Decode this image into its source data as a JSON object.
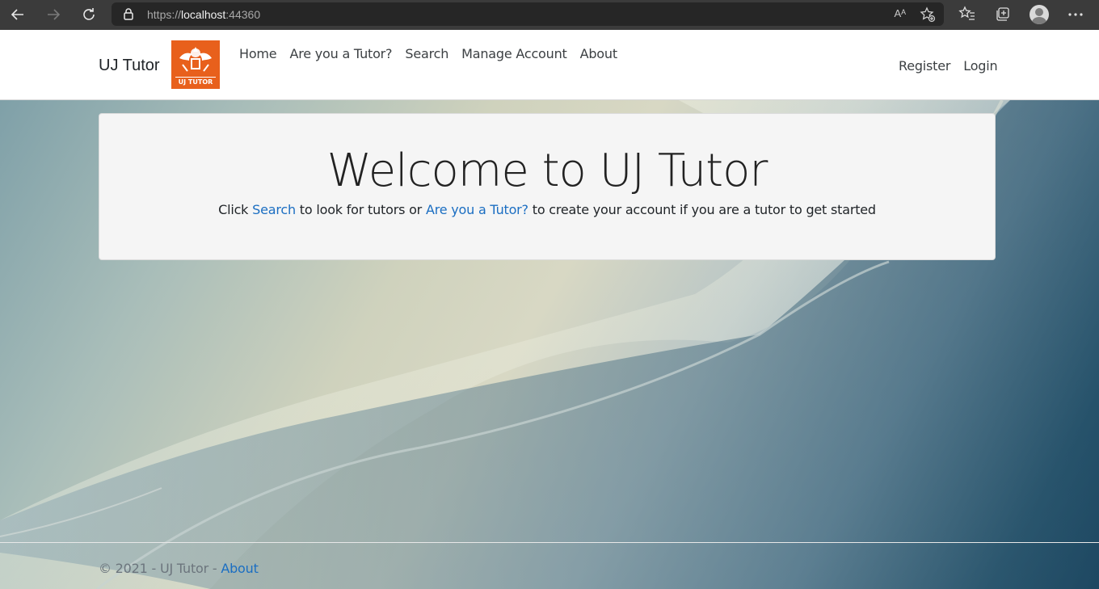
{
  "browser": {
    "url_prefix": "https://",
    "url_host": "localhost",
    "url_suffix": ":44360",
    "read_aloud": "Aᴬ"
  },
  "site": {
    "brand": "UJ Tutor",
    "logo_text": "UJ TUTOR",
    "nav": {
      "home": "Home",
      "tutor": "Are you a Tutor?",
      "search": "Search",
      "manage": "Manage Account",
      "about": "About"
    },
    "auth": {
      "register": "Register",
      "login": "Login"
    }
  },
  "jumbotron": {
    "title": "Welcome to UJ Tutor",
    "text_1": "Click ",
    "link_search": "Search",
    "text_2": " to look for tutors or ",
    "link_tutor": "Are you a Tutor?",
    "text_3": " to create your account if you are a tutor to get started"
  },
  "footer": {
    "text": "© 2021 - UJ Tutor - ",
    "link": "About"
  },
  "colors": {
    "link": "#1b6ec2",
    "logo_bg": "#e8601c",
    "chrome_bg": "#3b3b3b"
  }
}
